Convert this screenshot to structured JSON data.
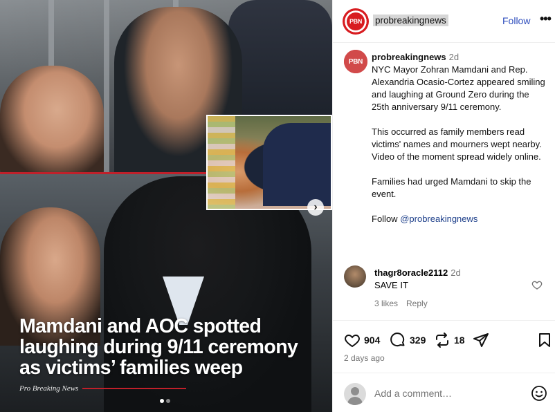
{
  "post": {
    "headline": "Mamdani and AOC spotted laughing during 9/11 ceremony as victims’ families weep",
    "brand": "Pro Breaking News",
    "carousel": {
      "total_slides": 2,
      "active_slide": 1
    }
  },
  "header": {
    "avatar_text": "PBN",
    "username": "probreakingnews",
    "follow_label": "Follow",
    "more_label": "•••"
  },
  "caption": {
    "avatar_text": "PBN",
    "username": "probreakingnews",
    "time": "2d",
    "text1": "NYC Mayor Zohran Mamdani and Rep. Alexandria Ocasio-Cortez appeared smiling and laughing at Ground Zero during the 25th anniversary 9/11 ceremony.",
    "text2": "This occurred as family members read victims' names and mourners wept nearby. Video of the moment spread widely online.",
    "text3": "Families had urged Mamdani to skip the event.",
    "follow_prefix": "Follow",
    "mention": "@probreakingnews"
  },
  "comments": [
    {
      "username": "thagr8oracle2112",
      "time": "2d",
      "text": "SAVE IT",
      "likes": "3 likes",
      "reply_label": "Reply"
    }
  ],
  "actions": {
    "likes": "904",
    "comments": "329",
    "shares": "18",
    "date": "2 days ago"
  },
  "comment_input": {
    "placeholder": "Add a comment…"
  },
  "colors": {
    "accent_red": "#d81c20",
    "link_blue": "#2f4ebd"
  }
}
